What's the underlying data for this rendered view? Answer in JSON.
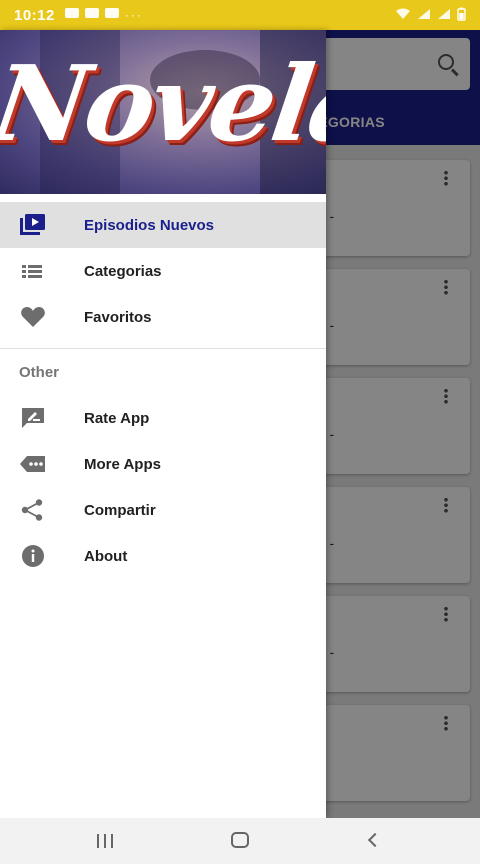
{
  "status_bar": {
    "time": "10:12",
    "dots": "···"
  },
  "background": {
    "tab_label": "ATEGORIAS",
    "card_snippets": [
      "ad -",
      "ad -",
      "ad -",
      "ad -",
      "ad -",
      ""
    ]
  },
  "drawer": {
    "banner_title": "Novelas",
    "primary_items": [
      {
        "label": "Episodios Nuevos",
        "icon": "video-library-icon",
        "active": true
      },
      {
        "label": "Categorias",
        "icon": "list-icon",
        "active": false
      },
      {
        "label": "Favoritos",
        "icon": "heart-icon",
        "active": false
      }
    ],
    "other_header": "Other",
    "other_items": [
      {
        "label": "Rate App",
        "icon": "rate-review-icon"
      },
      {
        "label": "More Apps",
        "icon": "more-apps-icon"
      },
      {
        "label": "Compartir",
        "icon": "share-icon"
      },
      {
        "label": "About",
        "icon": "info-icon"
      }
    ]
  },
  "colors": {
    "accent": "#1b1f8c",
    "status_bar": "#e8c81a",
    "icon_gray": "#6d6d6d"
  }
}
